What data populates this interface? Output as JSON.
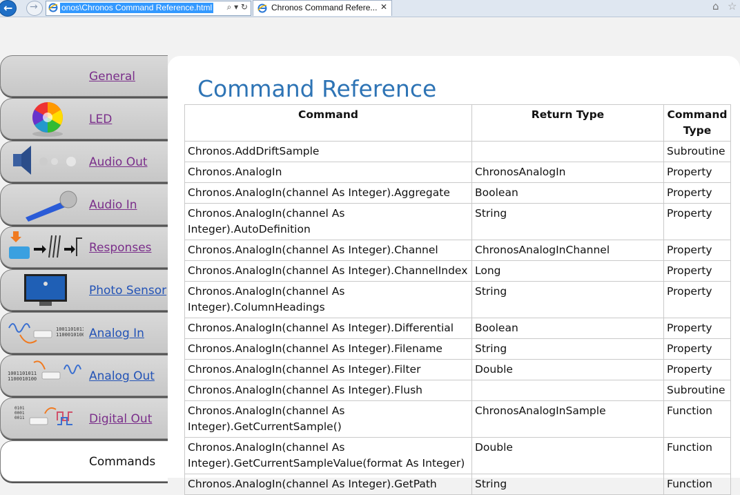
{
  "browser": {
    "address_url": "onos\\Chronos Command Reference.html",
    "address_tools": "⌕ ▾ ↻",
    "tab_title": "Chronos Command Refere...",
    "tab_close": "✕"
  },
  "sidebar": {
    "items": [
      {
        "label": "General",
        "icon": "none",
        "color": "#7a2e8a"
      },
      {
        "label": "LED",
        "icon": "color-wheel-icon",
        "color": "#7a2e8a"
      },
      {
        "label": "Audio Out",
        "icon": "speaker-icon",
        "color": "#7a2e8a"
      },
      {
        "label": "Audio In",
        "icon": "microphone-icon",
        "color": "#7a2e8a"
      },
      {
        "label": "Responses",
        "icon": "response-box-icon",
        "color": "#7a2e8a"
      },
      {
        "label": "Photo Sensor",
        "icon": "monitor-sensor-icon",
        "color": "#2353b6"
      },
      {
        "label": "Analog In",
        "icon": "analog-in-icon",
        "color": "#2353b6"
      },
      {
        "label": "Analog Out",
        "icon": "analog-out-icon",
        "color": "#2353b6"
      },
      {
        "label": "Digital Out",
        "icon": "digital-out-icon",
        "color": "#7a2e8a"
      },
      {
        "label": "Commands",
        "icon": "none",
        "active": true
      }
    ]
  },
  "main": {
    "title": "Command Reference",
    "table": {
      "headers": [
        "Command",
        "Return Type",
        "Command Type"
      ],
      "rows": [
        [
          "Chronos.AddDriftSample",
          "",
          "Subroutine"
        ],
        [
          "Chronos.AnalogIn",
          "ChronosAnalogIn",
          "Property"
        ],
        [
          "Chronos.AnalogIn(channel As Integer).Aggregate",
          "Boolean",
          "Property"
        ],
        [
          "Chronos.AnalogIn(channel As Integer).AutoDefinition",
          "String",
          "Property"
        ],
        [
          "Chronos.AnalogIn(channel As Integer).Channel",
          "ChronosAnalogInChannel",
          "Property"
        ],
        [
          "Chronos.AnalogIn(channel As Integer).ChannelIndex",
          "Long",
          "Property"
        ],
        [
          "Chronos.AnalogIn(channel As Integer).ColumnHeadings",
          "String",
          "Property"
        ],
        [
          "Chronos.AnalogIn(channel As Integer).Differential",
          "Boolean",
          "Property"
        ],
        [
          "Chronos.AnalogIn(channel As Integer).Filename",
          "String",
          "Property"
        ],
        [
          "Chronos.AnalogIn(channel As Integer).Filter",
          "Double",
          "Property"
        ],
        [
          "Chronos.AnalogIn(channel As Integer).Flush",
          "",
          "Subroutine"
        ],
        [
          "Chronos.AnalogIn(channel As Integer).GetCurrentSample()",
          "ChronosAnalogInSample",
          "Function"
        ],
        [
          "Chronos.AnalogIn(channel As Integer).GetCurrentSampleValue(format As Integer)",
          "Double",
          "Function"
        ],
        [
          "Chronos.AnalogIn(channel As Integer).GetPath",
          "String",
          "Function"
        ]
      ]
    }
  }
}
